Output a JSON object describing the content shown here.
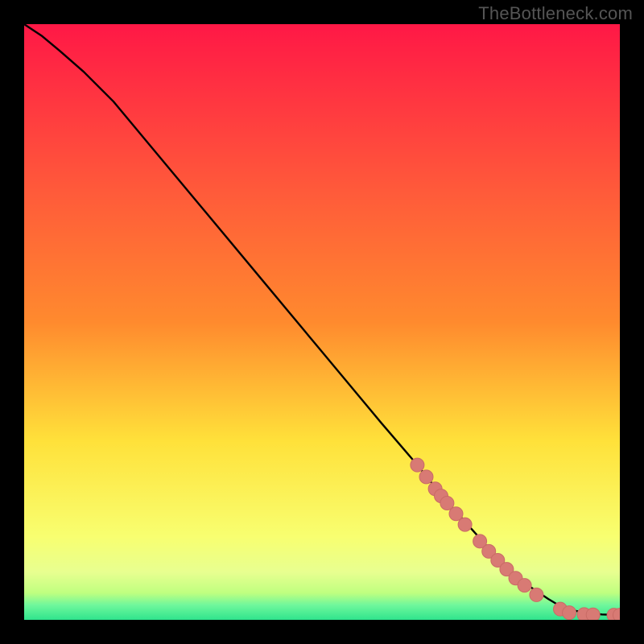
{
  "watermark": "TheBottleneck.com",
  "colors": {
    "frame": "#000000",
    "gradient_top": "#ff1846",
    "gradient_mid1": "#ff8a2e",
    "gradient_mid2": "#ffe13a",
    "gradient_mid3": "#f8ff70",
    "gradient_band": "#bfff80",
    "gradient_bottom": "#2fe48d",
    "curve": "#000000",
    "dot_fill": "#d87a74",
    "dot_stroke": "#c96b65"
  },
  "chart_data": {
    "type": "line",
    "title": "",
    "xlabel": "",
    "ylabel": "",
    "xlim": [
      0,
      100
    ],
    "ylim": [
      0,
      100
    ],
    "series": [
      {
        "name": "bottleneck-curve",
        "x": [
          0,
          3,
          6,
          10,
          15,
          20,
          30,
          40,
          50,
          60,
          66,
          70,
          74,
          78,
          82,
          85,
          88,
          90,
          92,
          95,
          97,
          100
        ],
        "y": [
          100,
          98,
          95.5,
          92,
          87,
          81,
          69,
          57,
          45,
          33,
          26,
          21,
          16.5,
          12,
          8,
          5.5,
          3.5,
          2.3,
          1.6,
          1.1,
          0.9,
          0.8
        ]
      }
    ],
    "highlight_dots": {
      "name": "highlighted-points",
      "points": [
        {
          "x": 66,
          "y": 26
        },
        {
          "x": 67.5,
          "y": 24
        },
        {
          "x": 69,
          "y": 22
        },
        {
          "x": 70,
          "y": 20.8
        },
        {
          "x": 71,
          "y": 19.6
        },
        {
          "x": 72.5,
          "y": 17.8
        },
        {
          "x": 74,
          "y": 16
        },
        {
          "x": 76.5,
          "y": 13.2
        },
        {
          "x": 78,
          "y": 11.5
        },
        {
          "x": 79.5,
          "y": 10
        },
        {
          "x": 81,
          "y": 8.5
        },
        {
          "x": 82.5,
          "y": 7
        },
        {
          "x": 84,
          "y": 5.8
        },
        {
          "x": 86,
          "y": 4.2
        },
        {
          "x": 90,
          "y": 1.8
        },
        {
          "x": 91.5,
          "y": 1.2
        },
        {
          "x": 94,
          "y": 0.9
        },
        {
          "x": 95.5,
          "y": 0.85
        },
        {
          "x": 99,
          "y": 0.8
        },
        {
          "x": 100,
          "y": 0.8
        }
      ]
    }
  }
}
